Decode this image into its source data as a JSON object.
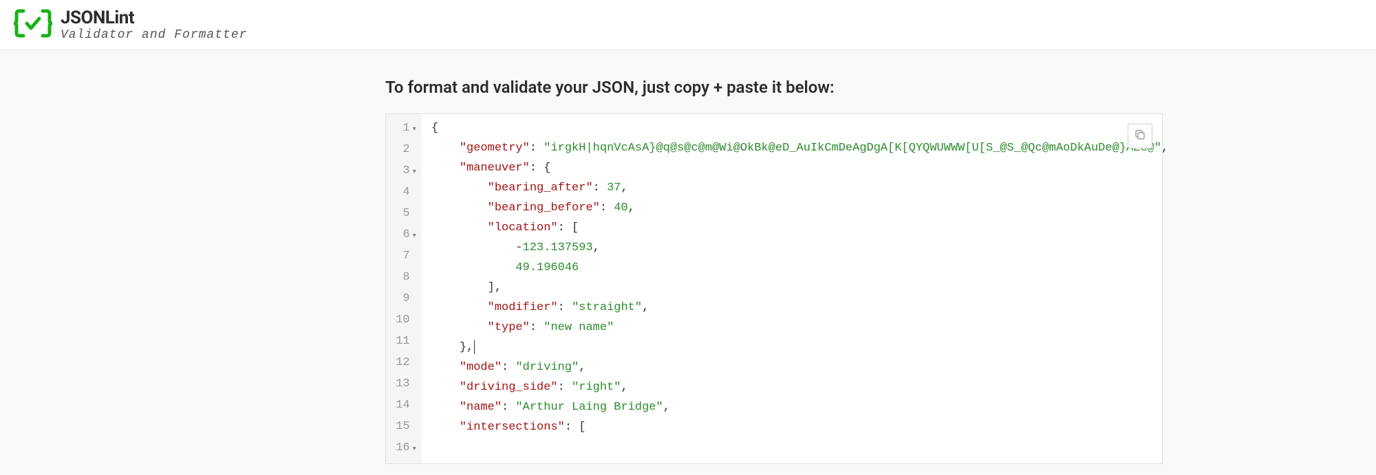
{
  "brand": {
    "title": "JSONLint",
    "subtitle": "Validator and Formatter"
  },
  "instruction": "To format and validate your JSON, just copy + paste it below:",
  "editor": {
    "lines": [
      {
        "num": "1",
        "fold": true,
        "tokens": [
          {
            "t": "punct",
            "v": "{"
          }
        ]
      },
      {
        "num": "2",
        "fold": false,
        "tokens": [
          {
            "t": "plain",
            "v": "    "
          },
          {
            "t": "key",
            "v": "\"geometry\""
          },
          {
            "t": "punct",
            "v": ": "
          },
          {
            "t": "string",
            "v": "\"irgkH|hqnVcAsA}@q@s@c@m@Wi@OkBk@eD_AuIkCmDeAgDgA[K[QYQWUWWW[U[S_@S_@Qc@mAoDkAuDe@}AEc@\""
          },
          {
            "t": "punct",
            "v": ","
          }
        ]
      },
      {
        "num": "3",
        "fold": true,
        "tokens": [
          {
            "t": "plain",
            "v": "    "
          },
          {
            "t": "key",
            "v": "\"maneuver\""
          },
          {
            "t": "punct",
            "v": ": {"
          }
        ]
      },
      {
        "num": "4",
        "fold": false,
        "tokens": [
          {
            "t": "plain",
            "v": "        "
          },
          {
            "t": "key",
            "v": "\"bearing_after\""
          },
          {
            "t": "punct",
            "v": ": "
          },
          {
            "t": "number",
            "v": "37"
          },
          {
            "t": "punct",
            "v": ","
          }
        ]
      },
      {
        "num": "5",
        "fold": false,
        "tokens": [
          {
            "t": "plain",
            "v": "        "
          },
          {
            "t": "key",
            "v": "\"bearing_before\""
          },
          {
            "t": "punct",
            "v": ": "
          },
          {
            "t": "number",
            "v": "40"
          },
          {
            "t": "punct",
            "v": ","
          }
        ]
      },
      {
        "num": "6",
        "fold": true,
        "tokens": [
          {
            "t": "plain",
            "v": "        "
          },
          {
            "t": "key",
            "v": "\"location\""
          },
          {
            "t": "punct",
            "v": ": ["
          }
        ]
      },
      {
        "num": "7",
        "fold": false,
        "tokens": [
          {
            "t": "plain",
            "v": "            "
          },
          {
            "t": "punct",
            "v": "-"
          },
          {
            "t": "number",
            "v": "123.137593"
          },
          {
            "t": "punct",
            "v": ","
          }
        ]
      },
      {
        "num": "8",
        "fold": false,
        "tokens": [
          {
            "t": "plain",
            "v": "            "
          },
          {
            "t": "number",
            "v": "49.196046"
          }
        ]
      },
      {
        "num": "9",
        "fold": false,
        "tokens": [
          {
            "t": "plain",
            "v": "        "
          },
          {
            "t": "punct",
            "v": "],"
          }
        ]
      },
      {
        "num": "10",
        "fold": false,
        "tokens": [
          {
            "t": "plain",
            "v": "        "
          },
          {
            "t": "key",
            "v": "\"modifier\""
          },
          {
            "t": "punct",
            "v": ": "
          },
          {
            "t": "string",
            "v": "\"straight\""
          },
          {
            "t": "punct",
            "v": ","
          }
        ]
      },
      {
        "num": "11",
        "fold": false,
        "tokens": [
          {
            "t": "plain",
            "v": "        "
          },
          {
            "t": "key",
            "v": "\"type\""
          },
          {
            "t": "punct",
            "v": ": "
          },
          {
            "t": "string",
            "v": "\"new name\""
          }
        ]
      },
      {
        "num": "12",
        "fold": false,
        "tokens": [
          {
            "t": "plain",
            "v": "    "
          },
          {
            "t": "punct",
            "v": "},"
          },
          {
            "t": "cursor",
            "v": ""
          }
        ]
      },
      {
        "num": "13",
        "fold": false,
        "tokens": [
          {
            "t": "plain",
            "v": "    "
          },
          {
            "t": "key",
            "v": "\"mode\""
          },
          {
            "t": "punct",
            "v": ": "
          },
          {
            "t": "string",
            "v": "\"driving\""
          },
          {
            "t": "punct",
            "v": ","
          }
        ]
      },
      {
        "num": "14",
        "fold": false,
        "tokens": [
          {
            "t": "plain",
            "v": "    "
          },
          {
            "t": "key",
            "v": "\"driving_side\""
          },
          {
            "t": "punct",
            "v": ": "
          },
          {
            "t": "string",
            "v": "\"right\""
          },
          {
            "t": "punct",
            "v": ","
          }
        ]
      },
      {
        "num": "15",
        "fold": false,
        "tokens": [
          {
            "t": "plain",
            "v": "    "
          },
          {
            "t": "key",
            "v": "\"name\""
          },
          {
            "t": "punct",
            "v": ": "
          },
          {
            "t": "string",
            "v": "\"Arthur Laing Bridge\""
          },
          {
            "t": "punct",
            "v": ","
          }
        ]
      },
      {
        "num": "16",
        "fold": true,
        "tokens": [
          {
            "t": "plain",
            "v": "    "
          },
          {
            "t": "key",
            "v": "\"intersections\""
          },
          {
            "t": "punct",
            "v": ": ["
          }
        ]
      }
    ]
  }
}
